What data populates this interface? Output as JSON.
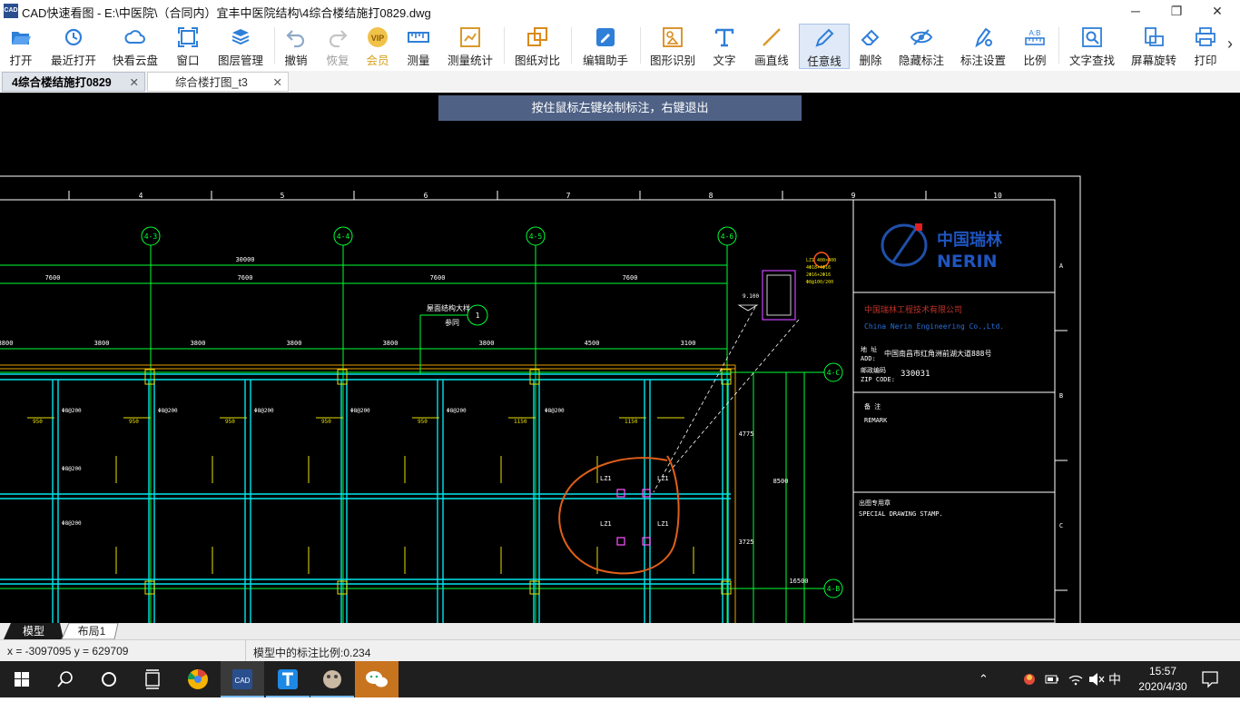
{
  "window": {
    "app_icon": "CAD",
    "title": "CAD快速看图 - E:\\中医院\\（合同内）宜丰中医院结构\\4综合楼结施打0829.dwg",
    "minimize_icon": "─",
    "maximize_icon": "❐",
    "close_icon": "✕"
  },
  "toolbar": {
    "items": [
      {
        "label": "打开",
        "icon": "folder-open-icon"
      },
      {
        "label": "最近打开",
        "icon": "recent-clock-icon"
      },
      {
        "label": "快看云盘",
        "icon": "cloud-icon"
      },
      {
        "label": "窗口",
        "icon": "window-icon"
      },
      {
        "label": "图层管理",
        "icon": "layers-icon"
      },
      {
        "label": "撤销",
        "icon": "undo-icon"
      },
      {
        "label": "恢复",
        "icon": "redo-icon"
      },
      {
        "label": "会员",
        "icon": "vip-icon"
      },
      {
        "label": "测量",
        "icon": "ruler-icon"
      },
      {
        "label": "测量统计",
        "icon": "measure-stats-icon"
      },
      {
        "label": "图纸对比",
        "icon": "compare-icon"
      },
      {
        "label": "编辑助手",
        "icon": "edit-assistant-icon"
      },
      {
        "label": "图形识别",
        "icon": "shape-recognize-icon"
      },
      {
        "label": "文字",
        "icon": "text-icon"
      },
      {
        "label": "画直线",
        "icon": "line-icon"
      },
      {
        "label": "任意线",
        "icon": "freehand-pen-icon"
      },
      {
        "label": "删除",
        "icon": "eraser-icon"
      },
      {
        "label": "隐藏标注",
        "icon": "eye-hide-icon"
      },
      {
        "label": "标注设置",
        "icon": "annotation-settings-icon"
      },
      {
        "label": "比例",
        "icon": "scale-icon"
      },
      {
        "label": "文字查找",
        "icon": "text-search-icon"
      },
      {
        "label": "屏幕旋转",
        "icon": "screen-rotate-icon"
      },
      {
        "label": "打印",
        "icon": "printer-icon"
      }
    ],
    "overflow_icon": "›",
    "vip_text": "VIP",
    "scale_text": "A:B"
  },
  "tabs": [
    {
      "label": "4综合楼结施打0829",
      "close": "✕"
    },
    {
      "label": "综合楼打图_t3",
      "close": "✕"
    }
  ],
  "canvas": {
    "hint": "按住鼠标左键绘制标注，右键退出",
    "col_numbers": [
      "4",
      "5",
      "6",
      "7",
      "8",
      "9",
      "10"
    ],
    "grid_bubbles": [
      "4-3",
      "4-4",
      "4-5",
      "4-6",
      "4-C",
      "4-B"
    ],
    "dim_total": "30000",
    "dim_spans": [
      "7600",
      "7600",
      "7600",
      "7600"
    ],
    "dim_sub": [
      "3800",
      "3800",
      "3800",
      "3800",
      "3800",
      "3800",
      "4500",
      "3100"
    ],
    "elev_label": "9.100",
    "note_title": "屋面结构大样",
    "note_sub": "参同",
    "note_circle": "1",
    "right_dims": [
      "4775",
      "8500",
      "3725",
      "16500"
    ],
    "lz_labels": [
      "LZ1",
      "LZ1",
      "LZ1",
      "LZ1"
    ],
    "title_block": {
      "logo_cn": "中国瑞林",
      "logo_en": "NERIN",
      "company_cn": "中国瑞林工程技术有限公司",
      "company_en": "China  Nerin  Engineering  Co.,Ltd.",
      "addr_label_cn": "地 址",
      "addr_label_en": "ADD:",
      "address": "中国南昌市红角洲前湖大道888号",
      "zip_label_cn": "邮政编码",
      "zip_label_en": "ZIP CODE:",
      "zip": "330031",
      "remark_cn": "备  注",
      "remark_en": "REMARK",
      "stamp_cn": "出图专用章",
      "stamp_en": "SPECIAL DRAWING STAMP.",
      "row_letters": [
        "A",
        "B",
        "C"
      ]
    }
  },
  "layout_tabs": [
    "模型",
    "布局1"
  ],
  "status": {
    "coords": "x = -3097095  y = 629709",
    "scale": "模型中的标注比例:0.234"
  },
  "taskbar": {
    "time": "15:57",
    "date": "2020/4/30",
    "ime": "中",
    "apps": [
      "windows-start-icon",
      "search-icon",
      "cortana-icon",
      "task-view-icon",
      "browser-icon",
      "cad-viewer-icon",
      "text-app-icon",
      "game-icon",
      "wechat-icon"
    ]
  }
}
